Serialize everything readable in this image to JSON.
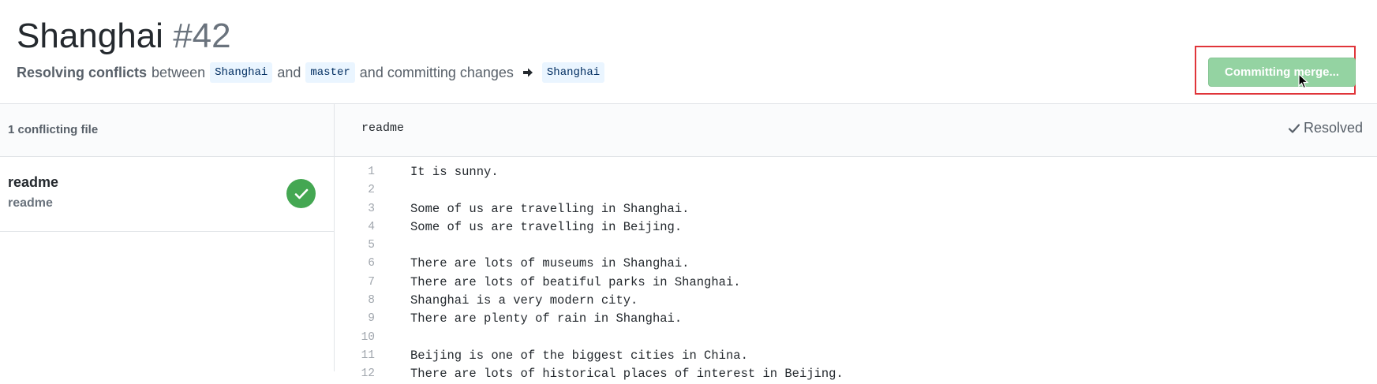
{
  "pr": {
    "title": "Shanghai",
    "number": "#42",
    "subtitle": {
      "strong": "Resolving conflicts",
      "between": "between",
      "branch_from": "Shanghai",
      "and": "and",
      "branch_to": "master",
      "committing": "and committing changes",
      "target_branch": "Shanghai",
      "arrow_icon": "arrow-right-icon"
    }
  },
  "actions": {
    "commit_label": "Committing merge...",
    "commit_state": "disabled",
    "commit_color": "#94d3a2",
    "highlight_color": "#e0353a"
  },
  "sidebar": {
    "header": "1 conflicting file",
    "files": [
      {
        "name": "readme",
        "path": "readme",
        "status_icon": "check-circle-icon",
        "status_color": "#44a752"
      }
    ]
  },
  "editor": {
    "filename": "readme",
    "status": "Resolved",
    "status_icon": "check-icon",
    "lines": [
      {
        "num": "1",
        "text": "It is sunny."
      },
      {
        "num": "2",
        "text": ""
      },
      {
        "num": "3",
        "text": "Some of us are travelling in Shanghai."
      },
      {
        "num": "4",
        "text": "Some of us are travelling in Beijing."
      },
      {
        "num": "5",
        "text": ""
      },
      {
        "num": "6",
        "text": "There are lots of museums in Shanghai."
      },
      {
        "num": "7",
        "text": "There are lots of beatiful parks in Shanghai."
      },
      {
        "num": "8",
        "text": "Shanghai is a very modern city."
      },
      {
        "num": "9",
        "text": "There are plenty of rain in Shanghai."
      },
      {
        "num": "10",
        "text": ""
      },
      {
        "num": "11",
        "text": "Beijing is one of the biggest cities in China."
      },
      {
        "num": "12",
        "text": "There are lots of historical places of interest in Beijing."
      }
    ]
  }
}
